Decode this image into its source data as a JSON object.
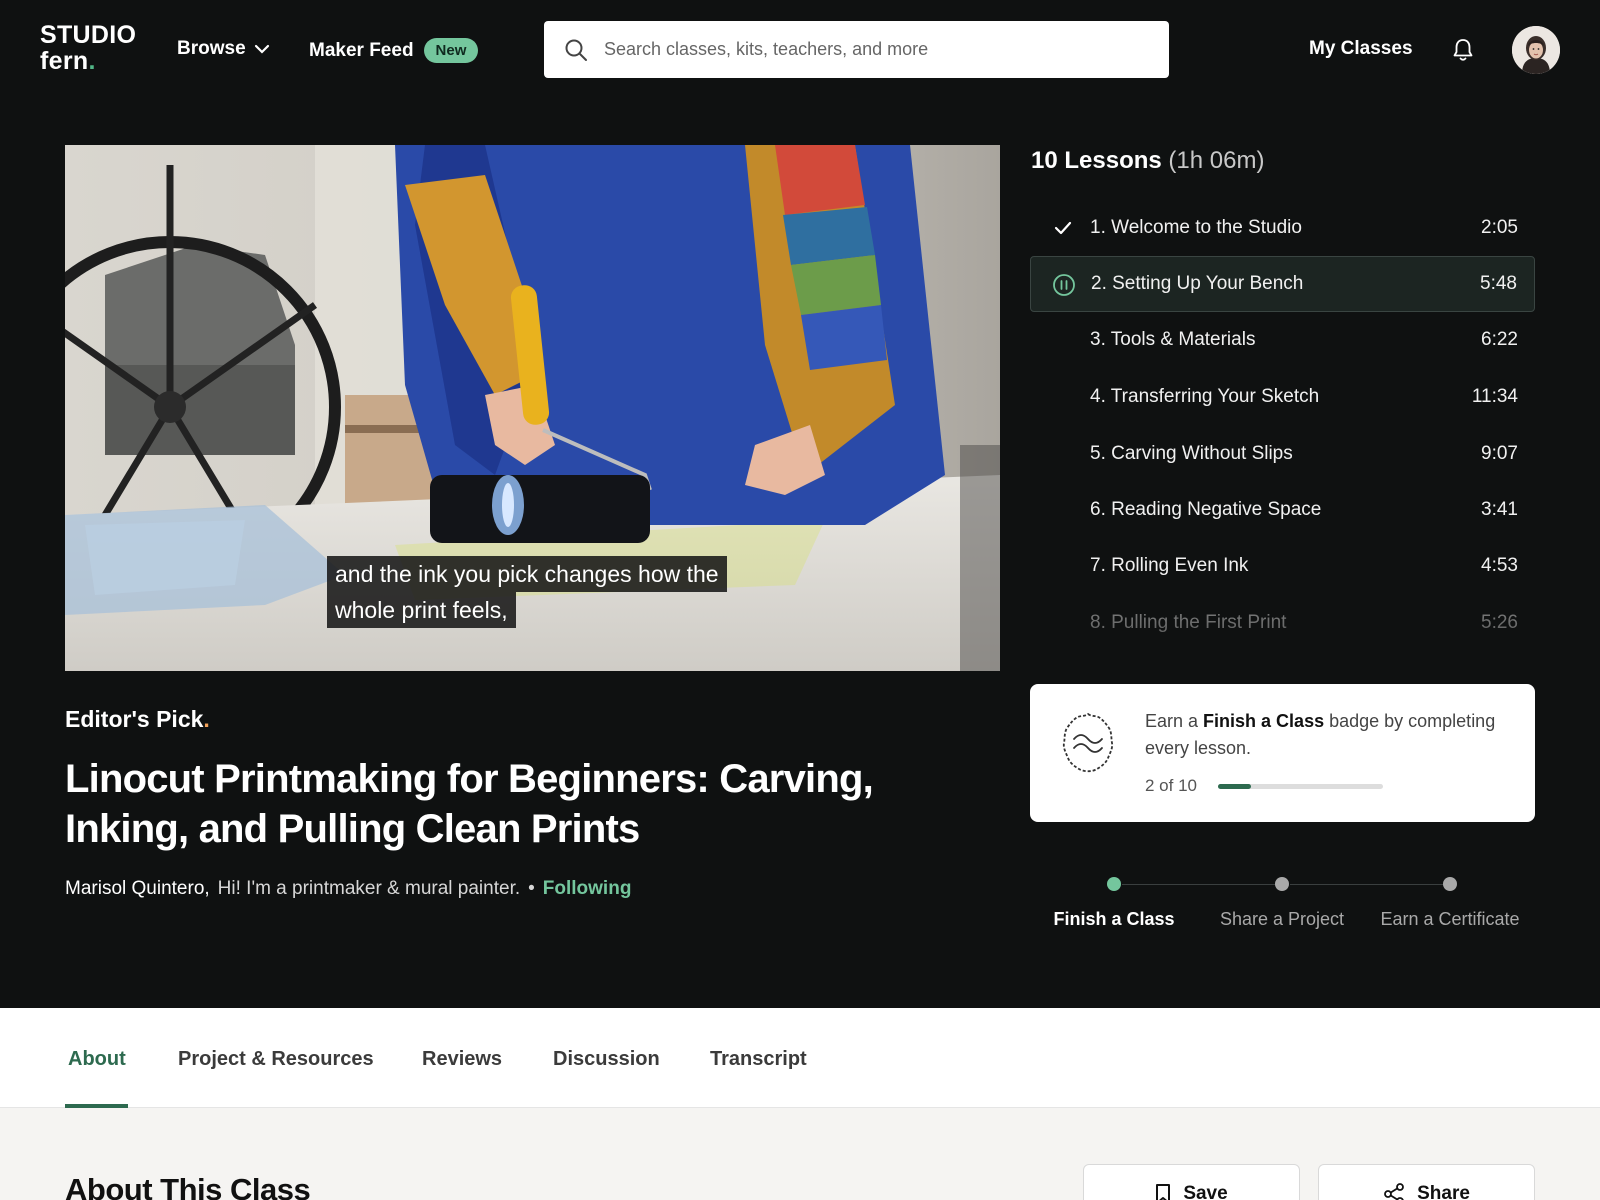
{
  "header": {
    "logo_line1": "STUDIO",
    "logo_line2": "fern",
    "logo_dot": ".",
    "browse_label": "Browse",
    "maker_feed_label": "Maker Feed",
    "maker_feed_badge": "New",
    "search_placeholder": "Search classes, kits, teachers, and more",
    "my_classes_label": "My Classes",
    "icons": [
      "chevron-down-icon",
      "search-icon",
      "bell-icon"
    ]
  },
  "video": {
    "caption_line1": "and the ink you pick changes how the",
    "caption_line2": "whole print feels,"
  },
  "class": {
    "editors_pick": "Editor's Pick",
    "editors_pick_dot": ".",
    "title": "Linocut Printmaking for Beginners: Carving, Inking, and Pulling Clean Prints",
    "teacher_name": "Marisol Quintero,",
    "teacher_tagline": "Hi! I'm a printmaker & mural painter.",
    "separator": "•",
    "follow_status": "Following"
  },
  "lessons": {
    "count_label": "10 Lessons",
    "duration_label": "(1h 06m)",
    "items": [
      {
        "title": "1. Welcome to the Studio",
        "time": "2:05",
        "state": "completed"
      },
      {
        "title": "2. Setting Up Your Bench",
        "time": "5:48",
        "state": "playing"
      },
      {
        "title": "3. Tools & Materials",
        "time": "6:22",
        "state": "none"
      },
      {
        "title": "4. Transferring Your Sketch",
        "time": "11:34",
        "state": "none"
      },
      {
        "title": "5. Carving Without Slips",
        "time": "9:07",
        "state": "none"
      },
      {
        "title": "6. Reading Negative Space",
        "time": "3:41",
        "state": "none"
      },
      {
        "title": "7. Rolling Even Ink",
        "time": "4:53",
        "state": "none"
      },
      {
        "title": "8. Pulling the First Print",
        "time": "5:26",
        "state": "none"
      }
    ]
  },
  "badge": {
    "text_pre": "Earn a ",
    "text_bold": "Finish a Class",
    "text_post": " badge by completing every lesson.",
    "progress_label": "2 of 10",
    "progress_fraction": 0.2,
    "accent_color": "#2d6a4f"
  },
  "steps": [
    {
      "label": "Finish a Class",
      "done": true
    },
    {
      "label": "Share a Project",
      "done": false
    },
    {
      "label": "Earn a Certificate",
      "done": false
    }
  ],
  "tabs": {
    "items": [
      "About",
      "Project & Resources",
      "Reviews",
      "Discussion",
      "Transcript"
    ],
    "active": "About"
  },
  "about": {
    "title": "About This Class",
    "save_label": "Save",
    "share_label": "Share"
  },
  "colors": {
    "background": "#0f1111",
    "accent_green": "#74c69d",
    "dark_green": "#2d6a4f"
  }
}
